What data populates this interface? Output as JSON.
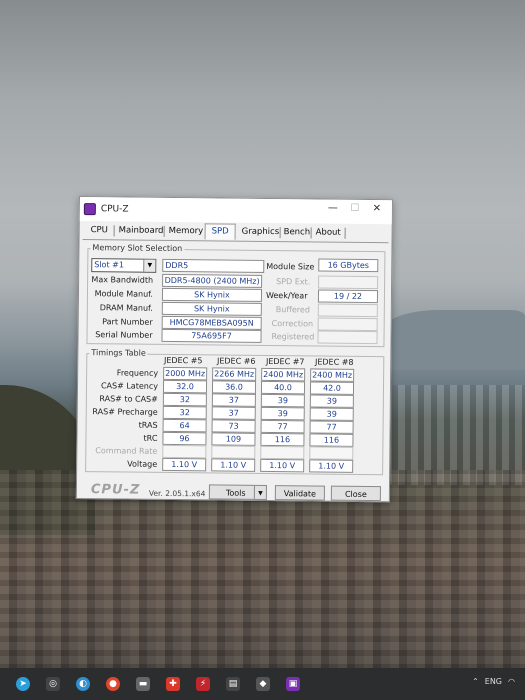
{
  "window": {
    "title": "CPU-Z",
    "controls": {
      "minimize": "—",
      "maximize": "☐",
      "close": "✕"
    }
  },
  "tabs": [
    "CPU",
    "Mainboard",
    "Memory",
    "SPD",
    "Graphics",
    "Bench",
    "About"
  ],
  "active_tab": "SPD",
  "slot_section": {
    "label": "Memory Slot Selection",
    "slot_selected": "Slot #1",
    "memory_type": "DDR5",
    "module_size_label": "Module Size",
    "module_size": "16 GBytes",
    "left_fields": [
      {
        "label": "Max Bandwidth",
        "value": "DDR5-4800 (2400 MHz)"
      },
      {
        "label": "Module Manuf.",
        "value": "SK Hynix"
      },
      {
        "label": "DRAM Manuf.",
        "value": "SK Hynix"
      },
      {
        "label": "Part Number",
        "value": "HMCG78MEBSA095N"
      },
      {
        "label": "Serial Number",
        "value": "75A695F7"
      }
    ],
    "right_fields": [
      {
        "label": "SPD Ext.",
        "value": "",
        "enabled": false
      },
      {
        "label": "Week/Year",
        "value": "19 / 22",
        "enabled": true
      },
      {
        "label": "Buffered",
        "value": "",
        "enabled": false
      },
      {
        "label": "Correction",
        "value": "",
        "enabled": false
      },
      {
        "label": "Registered",
        "value": "",
        "enabled": false
      }
    ]
  },
  "timings": {
    "label": "Timings Table",
    "columns": [
      "JEDEC #5",
      "JEDEC #6",
      "JEDEC #7",
      "JEDEC #8"
    ],
    "rows": [
      {
        "label": "Frequency",
        "values": [
          "2000 MHz",
          "2266 MHz",
          "2400 MHz",
          "2400 MHz"
        ],
        "enabled": true
      },
      {
        "label": "CAS# Latency",
        "values": [
          "32.0",
          "36.0",
          "40.0",
          "42.0"
        ],
        "enabled": true
      },
      {
        "label": "RAS# to CAS#",
        "values": [
          "32",
          "37",
          "39",
          "39"
        ],
        "enabled": true
      },
      {
        "label": "RAS# Precharge",
        "values": [
          "32",
          "37",
          "39",
          "39"
        ],
        "enabled": true
      },
      {
        "label": "tRAS",
        "values": [
          "64",
          "73",
          "77",
          "77"
        ],
        "enabled": true
      },
      {
        "label": "tRC",
        "values": [
          "96",
          "109",
          "116",
          "116"
        ],
        "enabled": true
      },
      {
        "label": "Command Rate",
        "values": [
          "",
          "",
          "",
          ""
        ],
        "enabled": false
      },
      {
        "label": "Voltage",
        "values": [
          "1.10 V",
          "1.10 V",
          "1.10 V",
          "1.10 V"
        ],
        "enabled": true
      }
    ]
  },
  "footer": {
    "brand": "CPU-Z",
    "version": "Ver. 2.05.1.x64",
    "tools_label": "Tools",
    "validate_label": "Validate",
    "close_label": "Close"
  },
  "taskbar": {
    "language": "ENG"
  }
}
